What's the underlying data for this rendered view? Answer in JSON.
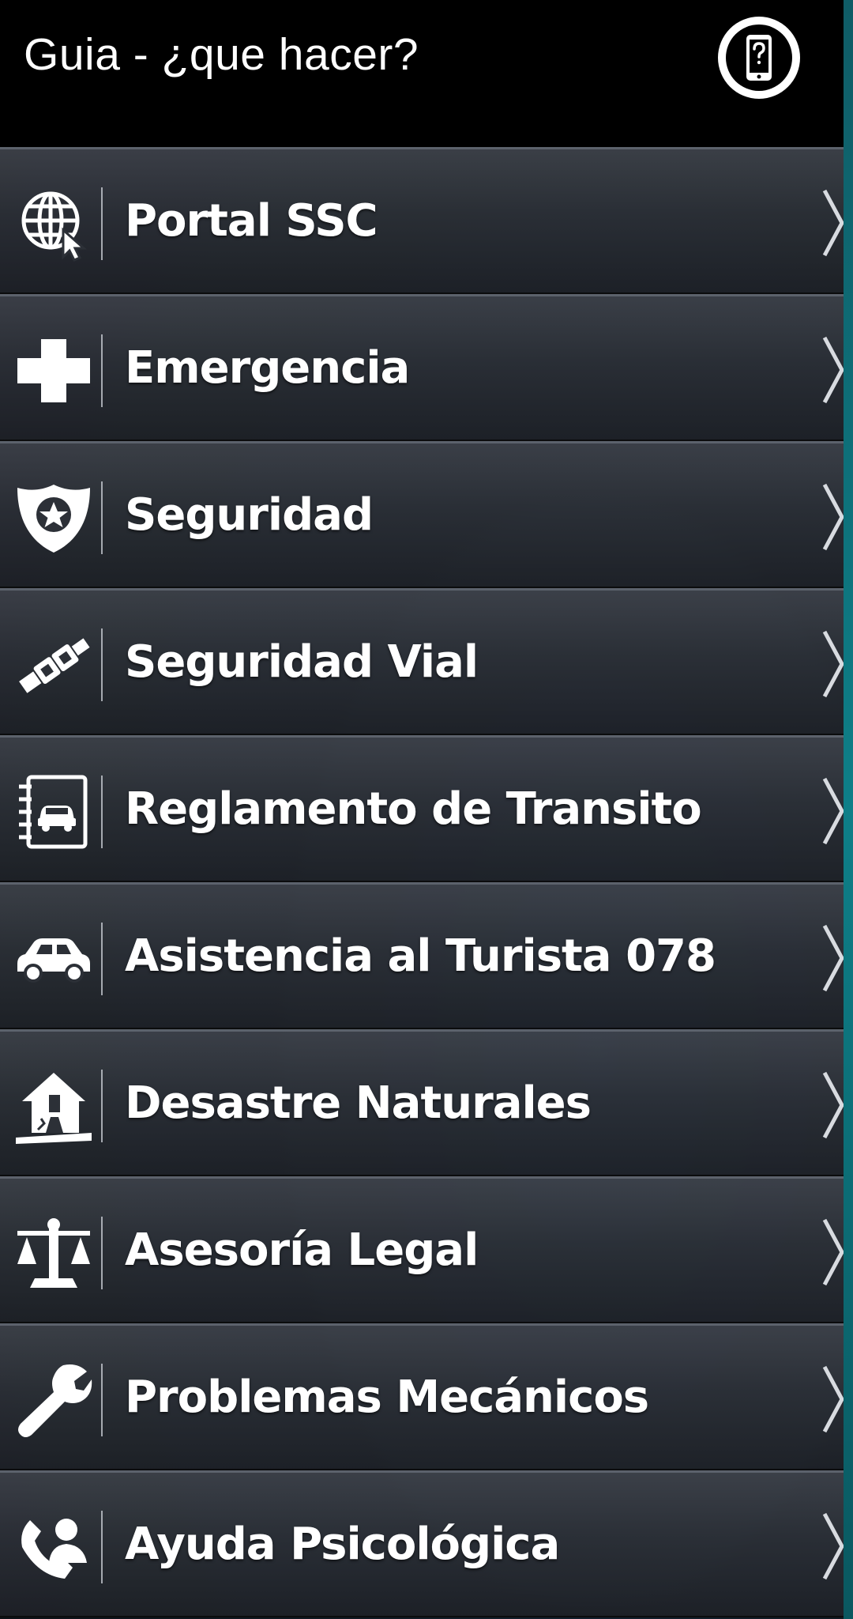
{
  "header": {
    "title": "Guia - ¿que hacer?",
    "help_icon": "phone-question-icon"
  },
  "menu": {
    "items": [
      {
        "label": "Portal SSC",
        "icon": "globe-cursor-icon"
      },
      {
        "label": "Emergencia",
        "icon": "medical-cross-icon"
      },
      {
        "label": "Seguridad",
        "icon": "shield-star-icon"
      },
      {
        "label": "Seguridad Vial",
        "icon": "seatbelt-icon"
      },
      {
        "label": "Reglamento de Transito",
        "icon": "rulebook-car-icon"
      },
      {
        "label": "Asistencia al Turista 078",
        "icon": "car-icon"
      },
      {
        "label": "Desastre Naturales",
        "icon": "collapsed-house-icon"
      },
      {
        "label": "Asesoría Legal",
        "icon": "scales-icon"
      },
      {
        "label": "Problemas Mecánicos",
        "icon": "wrench-icon"
      },
      {
        "label": "Ayuda Psicológica",
        "icon": "phone-person-icon"
      }
    ]
  },
  "colors": {
    "header_bg": "#000000",
    "row_top": "#3e424a",
    "row_bottom": "#1e2127",
    "text": "#ffffff",
    "edge_accent": "#0e7f88"
  }
}
